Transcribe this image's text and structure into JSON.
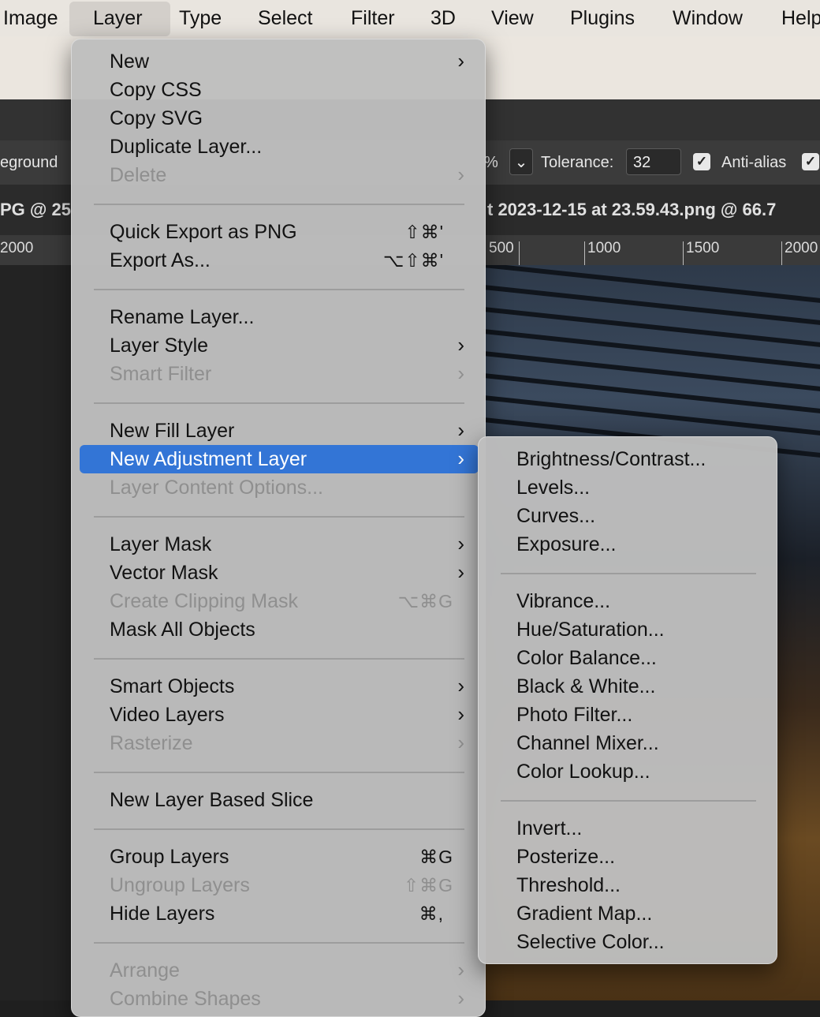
{
  "menubar": {
    "items": [
      {
        "label": "Image"
      },
      {
        "label": "Layer"
      },
      {
        "label": "Type"
      },
      {
        "label": "Select"
      },
      {
        "label": "Filter"
      },
      {
        "label": "3D"
      },
      {
        "label": "View"
      },
      {
        "label": "Plugins"
      },
      {
        "label": "Window"
      },
      {
        "label": "Help"
      }
    ]
  },
  "options_bar": {
    "source_fragment": "eground",
    "percent_fragment": "%",
    "tolerance_label": "Tolerance:",
    "tolerance_value": "32",
    "anti_alias_label": "Anti-alias",
    "anti_alias_checked": true
  },
  "doc_tabs": {
    "left_fragment": "PG @ 25",
    "right_fragment": "t 2023-12-15 at 23.59.43.png @ 66.7"
  },
  "ruler": {
    "labels": [
      "2000",
      "500",
      "1000",
      "1500",
      "2000"
    ]
  },
  "layer_menu": {
    "items": [
      {
        "label": "New",
        "submenu": true
      },
      {
        "label": "Copy CSS"
      },
      {
        "label": "Copy SVG"
      },
      {
        "label": "Duplicate Layer..."
      },
      {
        "label": "Delete",
        "submenu": true,
        "disabled": true
      },
      {
        "label": "Quick Export as PNG",
        "shortcut": "⇧⌘'"
      },
      {
        "label": "Export As...",
        "shortcut": "⌥⇧⌘'"
      },
      {
        "label": "Rename Layer..."
      },
      {
        "label": "Layer Style",
        "submenu": true
      },
      {
        "label": "Smart Filter",
        "submenu": true,
        "disabled": true
      },
      {
        "label": "New Fill Layer",
        "submenu": true
      },
      {
        "label": "New Adjustment Layer",
        "submenu": true,
        "highlighted": true
      },
      {
        "label": "Layer Content Options...",
        "disabled": true
      },
      {
        "label": "Layer Mask",
        "submenu": true
      },
      {
        "label": "Vector Mask",
        "submenu": true
      },
      {
        "label": "Create Clipping Mask",
        "shortcut": "⌥⌘G",
        "disabled": true
      },
      {
        "label": "Mask All Objects"
      },
      {
        "label": "Smart Objects",
        "submenu": true
      },
      {
        "label": "Video Layers",
        "submenu": true
      },
      {
        "label": "Rasterize",
        "submenu": true,
        "disabled": true
      },
      {
        "label": "New Layer Based Slice"
      },
      {
        "label": "Group Layers",
        "shortcut": "⌘G"
      },
      {
        "label": "Ungroup Layers",
        "shortcut": "⇧⌘G",
        "disabled": true
      },
      {
        "label": "Hide Layers",
        "shortcut": "⌘,"
      },
      {
        "label": "Arrange",
        "submenu": true,
        "disabled": true
      },
      {
        "label": "Combine Shapes",
        "submenu": true,
        "disabled": true
      }
    ]
  },
  "adjustment_submenu": {
    "items": [
      {
        "label": "Brightness/Contrast..."
      },
      {
        "label": "Levels..."
      },
      {
        "label": "Curves..."
      },
      {
        "label": "Exposure..."
      },
      {
        "label": "Vibrance..."
      },
      {
        "label": "Hue/Saturation..."
      },
      {
        "label": "Color Balance..."
      },
      {
        "label": "Black & White..."
      },
      {
        "label": "Photo Filter..."
      },
      {
        "label": "Channel Mixer..."
      },
      {
        "label": "Color Lookup..."
      },
      {
        "label": "Invert..."
      },
      {
        "label": "Posterize..."
      },
      {
        "label": "Threshold..."
      },
      {
        "label": "Gradient Map..."
      },
      {
        "label": "Selective Color..."
      }
    ]
  },
  "icons": {
    "submenu_arrow": "chevron-right-icon",
    "checkbox": "checkmark-icon",
    "dropdown": "chevron-down-icon"
  },
  "colors": {
    "highlight": "#3375d6",
    "menu_bg": "#bebebe",
    "disabled_text": "#8f8f8f"
  }
}
